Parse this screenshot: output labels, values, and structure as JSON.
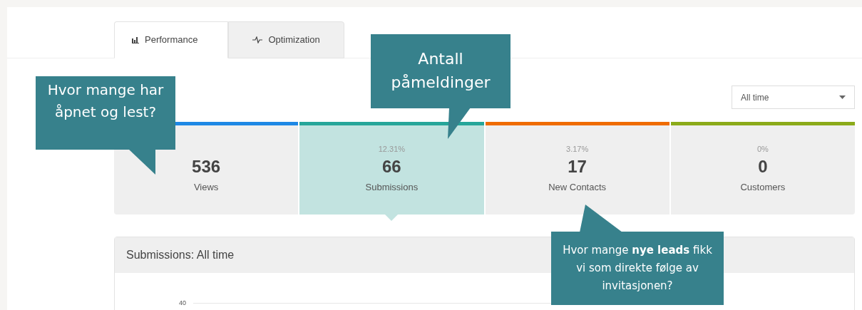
{
  "tabs": [
    {
      "label": "Performance",
      "selected": true
    },
    {
      "label": "Optimization",
      "selected": false
    }
  ],
  "range_select": {
    "value": "All time"
  },
  "stats": [
    {
      "value": "536",
      "label": "Views",
      "color": "#1e88e5",
      "selected": false
    },
    {
      "percent": "12.31%",
      "value": "66",
      "label": "Submissions",
      "color": "#26a69a",
      "selected": true
    },
    {
      "percent": "3.17%",
      "value": "17",
      "label": "New Contacts",
      "color": "#ef6c00",
      "selected": false
    },
    {
      "percent": "0%",
      "value": "0",
      "label": "Customers",
      "color": "#8bab1a",
      "selected": false
    }
  ],
  "chart_panel": {
    "title": "Submissions: All time",
    "y_tick": "40"
  },
  "callouts": [
    {
      "text": "Hvor mange har åpnet og lest?"
    },
    {
      "text": "Antall påmeldinger"
    },
    {
      "text": "Hvor mange **nye leads** fikk vi som direkte følge av invitasjonen?"
    }
  ]
}
